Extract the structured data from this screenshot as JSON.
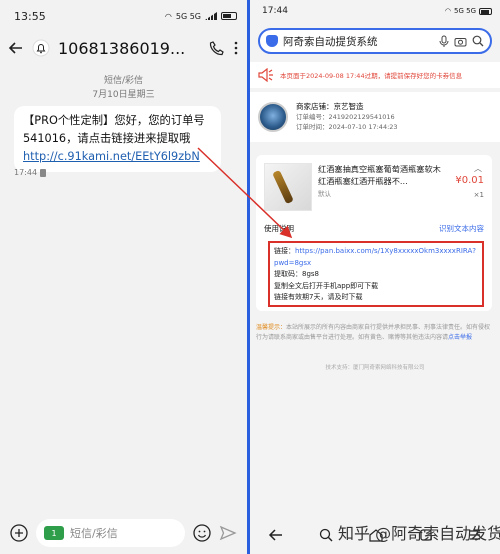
{
  "left": {
    "status": {
      "time": "13:55",
      "indicators": "5G 5G"
    },
    "header": {
      "number": "10681386019..."
    },
    "meta": {
      "type": "短信/彩信",
      "date": "7月10日星期三"
    },
    "message": {
      "text": "【PRO个性定制】您好，您的订单号541016，请点击链接进来提取哦",
      "link": "http://c.91kami.net/EEtY6l9zbN"
    },
    "msg_time": "17:44",
    "input": {
      "placeholder": "短信/彩信",
      "sim": "1"
    }
  },
  "right": {
    "status": {
      "time": "17:44",
      "indicators": "5G 5G"
    },
    "search": {
      "text": "阿奇索自动提货系统"
    },
    "notice": "本页面于2024-09-08 17:44过期，请提前保存好您的卡券信息",
    "shop": {
      "name": "商家店铺：京艺智造",
      "order": "订单编号：2419202129541016",
      "time": "订单时间：2024-07-10 17:44:23"
    },
    "product": {
      "title": "红酒塞抽真空瓶塞葡萄酒瓶塞软木红酒瓶塞红酒开瓶器不...",
      "spec": "默认",
      "price": "¥0.01",
      "qty": "×1"
    },
    "use_label": "使用说明",
    "recognize": "识别文本内容",
    "instructions": {
      "link_label": "链接：",
      "link": "https://pan.baixx.com/s/1Xy8xxxxxOkm3xxxxRIRA?pwd=8gsx",
      "code": "提取码：8gs8",
      "line3": "复制全文后打开手机app即可下载",
      "line4": "链接有效期7天，请及时下载"
    },
    "warning": {
      "label": "温馨提示：",
      "text": "本站所展示的所有内容由商家自行提供并承担民事、刑事法律责任。如有侵权行为请联系商家或由售平台进行处理。如有黄色、赌博等其他违法内容请",
      "report": "点击举报"
    },
    "tech": "技术支持：厦门阿奇索网络科技有限公司"
  },
  "watermark": "知乎 @阿奇索自动发货",
  "colors": {
    "accent": "#3a6be8",
    "alert": "#e0463a",
    "highlight_box": "#d9302a",
    "divider": "#2a5fe0"
  }
}
